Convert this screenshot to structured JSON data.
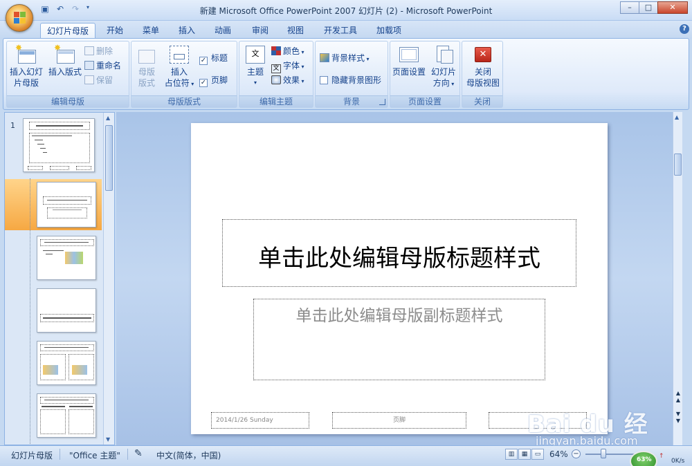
{
  "window": {
    "title": "新建 Microsoft Office PowerPoint 2007 幻灯片 (2) - Microsoft PowerPoint",
    "minimize": "–",
    "maximize": "□",
    "close": "✕"
  },
  "tabs": [
    {
      "label": "幻灯片母版",
      "active": true
    },
    {
      "label": "开始"
    },
    {
      "label": "菜单"
    },
    {
      "label": "插入"
    },
    {
      "label": "动画"
    },
    {
      "label": "审阅"
    },
    {
      "label": "视图"
    },
    {
      "label": "开发工具"
    },
    {
      "label": "加载项"
    }
  ],
  "ribbon": {
    "edit_master": {
      "label": "编辑母版",
      "insert_master_l1": "插入幻灯",
      "insert_master_l2": "片母版",
      "insert_layout": "插入版式",
      "delete": "删除",
      "rename": "重命名",
      "preserve": "保留"
    },
    "master_layout": {
      "label": "母版版式",
      "master_l1": "母版",
      "master_l2": "版式",
      "insert_ph_l1": "插入",
      "insert_ph_l2": "占位符",
      "title_check": "标题",
      "footer_check": "页脚"
    },
    "edit_theme": {
      "label": "编辑主题",
      "themes": "主题",
      "colors": "颜色",
      "fonts": "字体",
      "effects": "效果"
    },
    "background": {
      "label": "背景",
      "bg_styles": "背景样式",
      "hide_bg": "隐藏背景图形"
    },
    "page_setup": {
      "label": "页面设置",
      "page_setup_btn": "页面设置",
      "orientation_l1": "幻灯片",
      "orientation_l2": "方向"
    },
    "close": {
      "label": "关闭",
      "close_l1": "关闭",
      "close_l2": "母版视图"
    }
  },
  "thumbnails": {
    "first_number": "1"
  },
  "slide": {
    "title_placeholder": "单击此处编辑母版标题样式",
    "subtitle_placeholder": "单击此处编辑母版副标题样式",
    "date": "2014/1/26 Sunday",
    "footer": "页脚"
  },
  "statusbar": {
    "view_mode": "幻灯片母版",
    "theme": "\"Office 主题\"",
    "language": "中文(简体，中国)",
    "zoom": "64%"
  },
  "watermark": {
    "brand": "Bai du 经验",
    "url": "jingyan.baidu.com"
  },
  "net_widget": {
    "percent": "63%",
    "speed": "0K/s"
  }
}
